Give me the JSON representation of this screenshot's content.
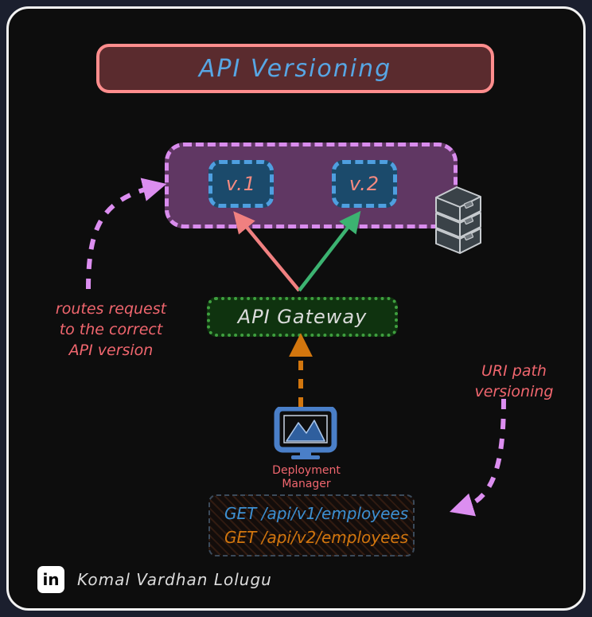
{
  "canvas": {
    "background": "#0d0d0d",
    "frame_border": "#f2f2f2",
    "outer_background": "#1b1f2e"
  },
  "title": {
    "text": "API Versioning",
    "text_color": "#57a6e4",
    "fill_color": "#5a2b2e",
    "border_color": "#ff8d8d"
  },
  "version_group": {
    "fill_color": "#603763",
    "border_color": "#d98ced",
    "versions": [
      {
        "label": "v.1",
        "fill_color": "#1b4a6b",
        "border_color": "#4e9fe0",
        "text_color": "#f58a80"
      },
      {
        "label": "v.2",
        "fill_color": "#1b4a6b",
        "border_color": "#4e9fe0",
        "text_color": "#f58a80"
      }
    ]
  },
  "server": {
    "icon": "server-stack-icon",
    "color": "#3a4248"
  },
  "gateway": {
    "label": "API Gateway",
    "text_color": "#dcdcdc",
    "fill_color": "#0f330f",
    "border_color": "#3f9f3f"
  },
  "annotations": {
    "routing_note": "routes request to the correct API version",
    "routing_note_lines": [
      "routes request",
      "to the correct",
      "API version"
    ],
    "routing_note_color": "#f0666e",
    "uri_note": "URI path versioning",
    "uri_note_lines": [
      "URI path",
      "versioning"
    ],
    "uri_note_color": "#f0666e"
  },
  "arrows": {
    "v1_arrow_color": "#f08080",
    "v2_arrow_color": "#3cb371",
    "gateway_arrow_color": "#d2760e",
    "routing_arrow_color": "#dc8ef0",
    "uri_arrow_color": "#dc8ef0"
  },
  "monitor": {
    "icon": "monitor-icon",
    "label_lines": [
      "Deployment",
      "Manager"
    ],
    "label": "Deployment Manager",
    "label_color": "#f0666e",
    "frame_color": "#4a7fc8"
  },
  "code_block": {
    "lines": [
      {
        "text": "GET /api/v1/employees",
        "color": "#3d8fd1"
      },
      {
        "text": "GET /api/v2/employees",
        "color": "#d2760e"
      }
    ],
    "border_color": "#3b4a5a"
  },
  "footer": {
    "badge": "in",
    "author": "Komal Vardhan Lolugu",
    "author_color": "#dcdcdc"
  }
}
